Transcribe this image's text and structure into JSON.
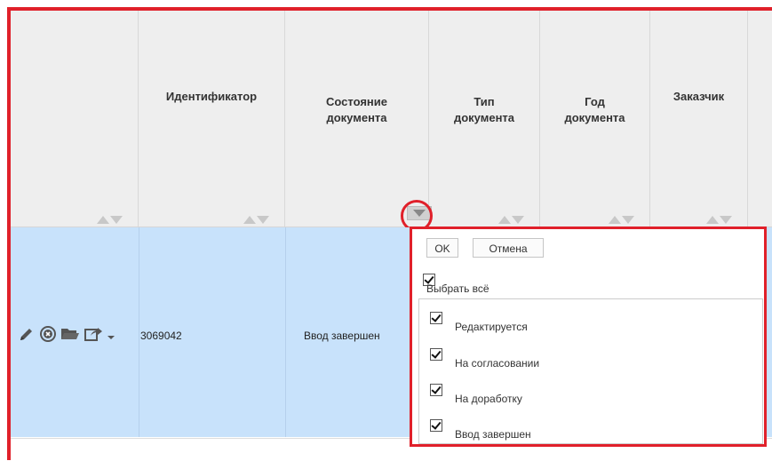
{
  "columns": [
    {
      "line1": "",
      "line2": ""
    },
    {
      "line1": "Идентификатор",
      "line2": ""
    },
    {
      "line1": "Состояние",
      "line2": "документа"
    },
    {
      "line1": "Тип",
      "line2": "документа"
    },
    {
      "line1": "Год",
      "line2": "документа"
    },
    {
      "line1": "Заказчик",
      "line2": ""
    }
  ],
  "row": {
    "id": "3069042",
    "state": "Ввод завершен"
  },
  "icons": [
    "edit-icon",
    "cancel-icon",
    "folder-icon",
    "share-icon",
    "dropdown-icon"
  ],
  "filter": {
    "ok": "OK",
    "cancel": "Отмена",
    "select_all": "Выбрать всё",
    "options": [
      "Редактируется",
      "На согласовании",
      "На доработку",
      "Ввод завершен"
    ]
  },
  "colors": {
    "highlight": "#e0202a",
    "row_selected": "#c8e2fb",
    "header_bg": "#eeeeee"
  }
}
